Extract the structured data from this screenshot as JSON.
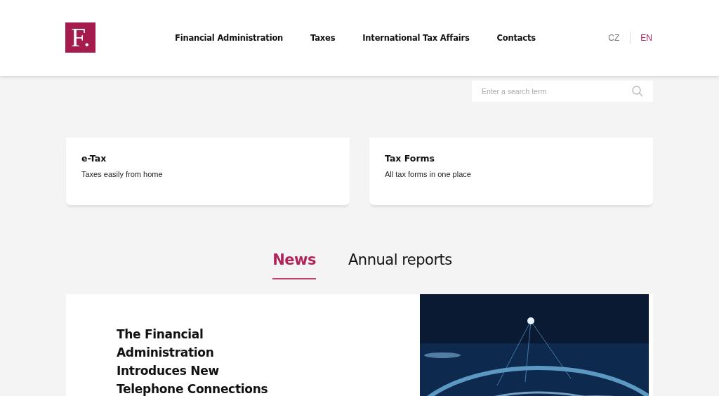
{
  "header": {
    "logo": "F.",
    "nav": [
      "Financial Administration",
      "Taxes",
      "International Tax Affairs",
      "Contacts"
    ],
    "languages": [
      {
        "label": "CZ",
        "selected": false
      },
      {
        "label": "EN",
        "selected": true
      }
    ]
  },
  "search": {
    "placeholder": "Enter a search term"
  },
  "cards": [
    {
      "title": "e-Tax",
      "subtitle": "Taxes easily from home"
    },
    {
      "title": "Tax Forms",
      "subtitle": "All tax forms in one place"
    }
  ],
  "tabs": [
    {
      "label": "News",
      "selected": true
    },
    {
      "label": "Annual reports",
      "selected": false
    }
  ],
  "article": {
    "title": "The Financial Administration Introduces New Telephone Connections"
  }
}
